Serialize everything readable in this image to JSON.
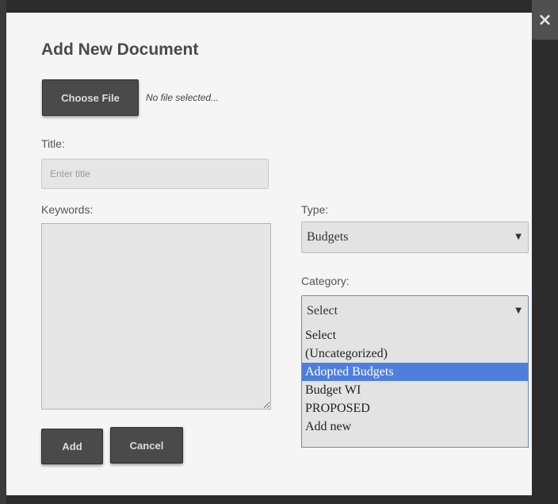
{
  "modal": {
    "title": "Add New Document",
    "close_glyph": "×"
  },
  "file": {
    "choose_label": "Choose File",
    "status": "No file selected..."
  },
  "title_field": {
    "label": "Title:",
    "placeholder": "Enter title",
    "value": ""
  },
  "keywords_field": {
    "label": "Keywords:",
    "value": ""
  },
  "type_field": {
    "label": "Type:",
    "selected": "Budgets"
  },
  "category_field": {
    "label": "Category:",
    "selected": "Select",
    "options": [
      "Select",
      "(Uncategorized)",
      "Adopted Budgets",
      "Budget WI",
      "PROPOSED",
      "Add new"
    ],
    "highlighted": "Adopted Budgets"
  },
  "actions": {
    "add_label": "Add",
    "cancel_label": "Cancel"
  },
  "icons": {
    "close": "close-icon",
    "caret": "chevron-down-icon",
    "resize": "resize-handle-icon"
  },
  "colors": {
    "modal_bg": "#f5f5f5",
    "button_bg": "#4a4a4a",
    "highlight": "#4f7fdc",
    "focus_border": "#6b84c9"
  }
}
